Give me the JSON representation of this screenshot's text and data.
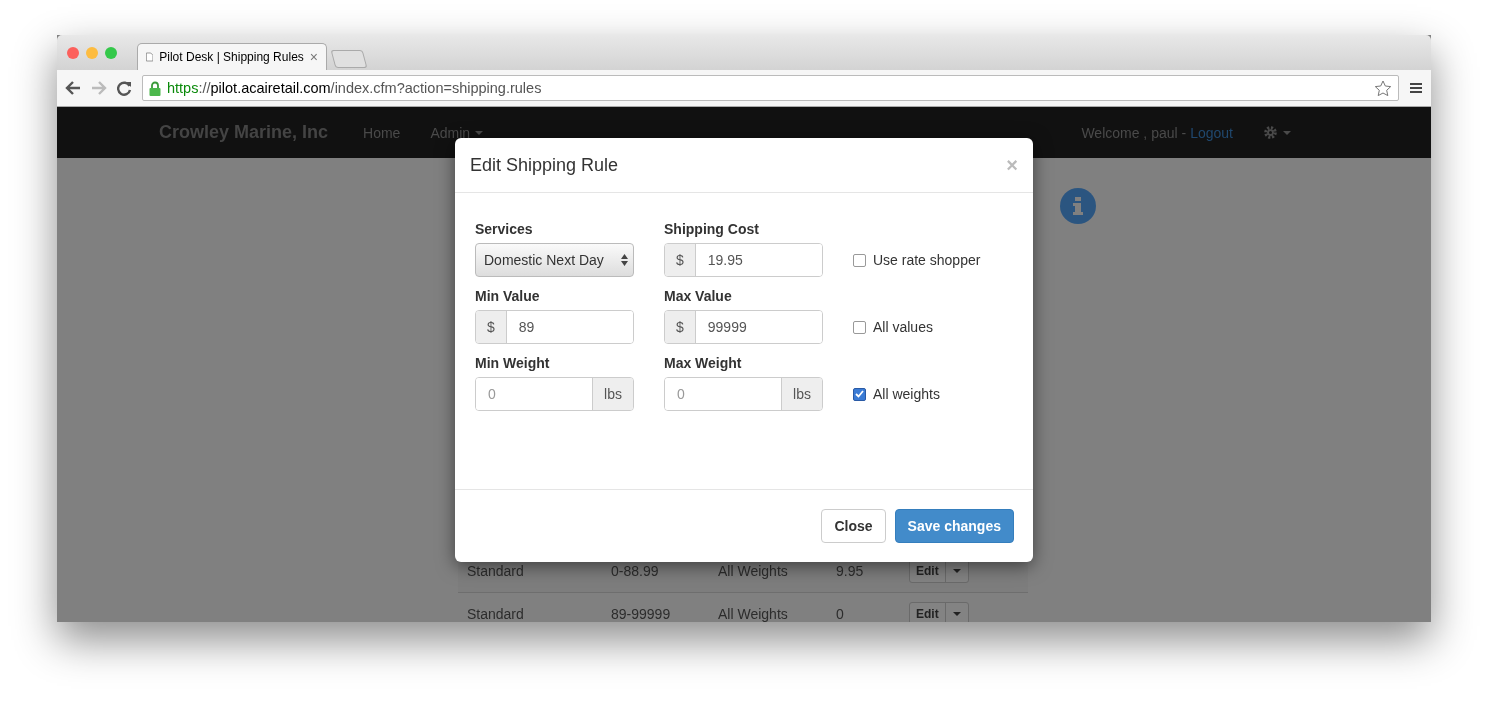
{
  "browser": {
    "tab_title": "Pilot Desk | Shipping Rules",
    "tab_close": "×",
    "url": [
      {
        "text": "https",
        "kind": "secure"
      },
      {
        "text": "://",
        "kind": "plain"
      },
      {
        "text": "pilot.acairetail.com",
        "kind": "host"
      },
      {
        "text": "/index.cfm?action=shipping.rules",
        "kind": "plain"
      }
    ]
  },
  "navbar": {
    "brand": "Crowley Marine, Inc",
    "items": [
      {
        "label": "Home",
        "dropdown": false
      },
      {
        "label": "Admin",
        "dropdown": true
      }
    ],
    "welcome": "Welcome , paul -",
    "logout": "Logout"
  },
  "table": {
    "rows": [
      {
        "cells": [
          "Standard",
          "0-88.99",
          "All Weights",
          "9.95"
        ],
        "action": "Edit"
      },
      {
        "cells": [
          "Standard",
          "89-99999",
          "All Weights",
          "0"
        ],
        "action": "Edit"
      }
    ]
  },
  "modal": {
    "title": "Edit Shipping Rule",
    "close": "×",
    "rows": [
      {
        "fields": [
          {
            "label": "Services",
            "kind": "select",
            "value": "Domestic Next Day"
          },
          {
            "label": "Shipping Cost",
            "kind": "prefix",
            "addon": "$",
            "value": "19.95"
          }
        ],
        "checkbox": {
          "label": "Use rate shopper",
          "checked": false
        }
      },
      {
        "fields": [
          {
            "label": "Min Value",
            "kind": "prefix",
            "addon": "$",
            "value": "89"
          },
          {
            "label": "Max Value",
            "kind": "prefix",
            "addon": "$",
            "value": "99999"
          }
        ],
        "checkbox": {
          "label": "All values",
          "checked": false
        }
      },
      {
        "fields": [
          {
            "label": "Min Weight",
            "kind": "suffix",
            "addon": "lbs",
            "placeholder": "0"
          },
          {
            "label": "Max Weight",
            "kind": "suffix",
            "addon": "lbs",
            "placeholder": "0"
          }
        ],
        "checkbox": {
          "label": "All weights",
          "checked": true
        }
      }
    ],
    "buttons": [
      {
        "label": "Close",
        "kind": "default"
      },
      {
        "label": "Save changes",
        "kind": "primary"
      }
    ]
  }
}
